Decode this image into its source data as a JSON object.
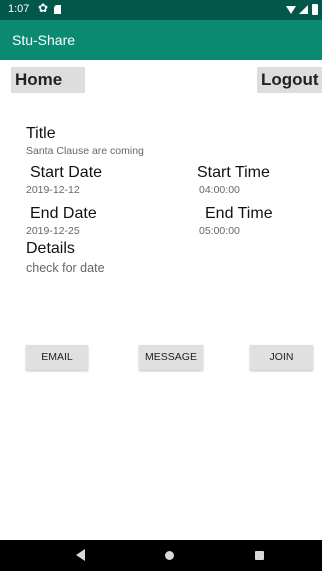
{
  "status_bar": {
    "time": "1:07"
  },
  "app_bar": {
    "title": "Stu-Share"
  },
  "top_buttons": {
    "home": "Home",
    "logout": "Logout"
  },
  "event": {
    "title_label": "Title",
    "title_value": "Santa Clause are coming",
    "start_date_label": "Start Date",
    "start_date_value": "2019-12-12",
    "start_time_label": "Start Time",
    "start_time_value": "04:00:00",
    "end_date_label": "End Date",
    "end_date_value": "2019-12-25",
    "end_time_label": "End Time",
    "end_time_value": "05:00:00",
    "details_label": "Details",
    "details_value": "check for date"
  },
  "actions": {
    "email": "EMAIL",
    "message": "MESSAGE",
    "join": "JOIN"
  },
  "icons": {
    "status": [
      "settings-gear-icon",
      "sd-card-icon",
      "wifi-icon",
      "cell-signal-icon",
      "battery-icon"
    ],
    "nav": [
      "back-icon",
      "home-circle-icon",
      "recents-square-icon"
    ]
  },
  "colors": {
    "status_bar": "#00574a",
    "app_bar": "#0b8a72",
    "button_bg": "#dddddd"
  }
}
